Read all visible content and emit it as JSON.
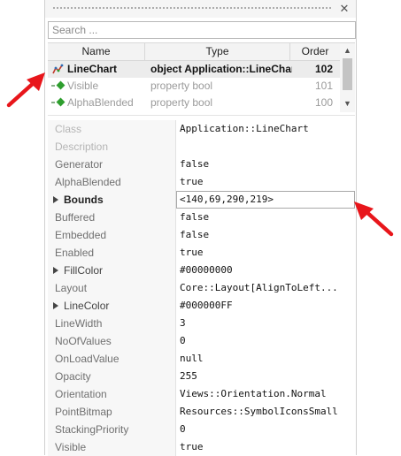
{
  "panel": {
    "close_glyph": "✕",
    "search_placeholder": "Search ..."
  },
  "list": {
    "columns": [
      "Name",
      "Type",
      "Order"
    ],
    "rows": [
      {
        "name": "LineChart",
        "type": "object Application::LineChart",
        "order": "102",
        "icon": "linechart-icon"
      },
      {
        "name": "Visible",
        "type": "property bool",
        "order": "101",
        "icon": "property-icon"
      },
      {
        "name": "AlphaBlended",
        "type": "property bool",
        "order": "100",
        "icon": "property-icon"
      }
    ],
    "scroll_up": "▲",
    "scroll_down": "▼"
  },
  "properties": [
    {
      "name": "Class",
      "value": "Application::LineChart",
      "readonly": true
    },
    {
      "name": "Description",
      "value": "",
      "readonly": true
    },
    {
      "name": "Generator",
      "value": "false"
    },
    {
      "name": "AlphaBlended",
      "value": "true"
    },
    {
      "name": "Bounds",
      "value": "<140,69,290,219>",
      "expandable": true,
      "bold": true,
      "editing": true
    },
    {
      "name": "Buffered",
      "value": "false"
    },
    {
      "name": "Embedded",
      "value": "false"
    },
    {
      "name": "Enabled",
      "value": "true"
    },
    {
      "name": "FillColor",
      "value": "#00000000",
      "expandable": true
    },
    {
      "name": "Layout",
      "value": "Core::Layout[AlignToLeft..."
    },
    {
      "name": "LineColor",
      "value": "#000000FF",
      "expandable": true
    },
    {
      "name": "LineWidth",
      "value": "3"
    },
    {
      "name": "NoOfValues",
      "value": "0"
    },
    {
      "name": "OnLoadValue",
      "value": "null"
    },
    {
      "name": "Opacity",
      "value": "255"
    },
    {
      "name": "Orientation",
      "value": "Views::Orientation.Normal"
    },
    {
      "name": "PointBitmap",
      "value": "Resources::SymbolIconsSmall"
    },
    {
      "name": "StackingPriority",
      "value": "0"
    },
    {
      "name": "Visible",
      "value": "true"
    }
  ],
  "colors": {
    "callout_arrow": "#e8161b",
    "selected_row": "#ececec",
    "property_icon": "#2e9e2e"
  }
}
